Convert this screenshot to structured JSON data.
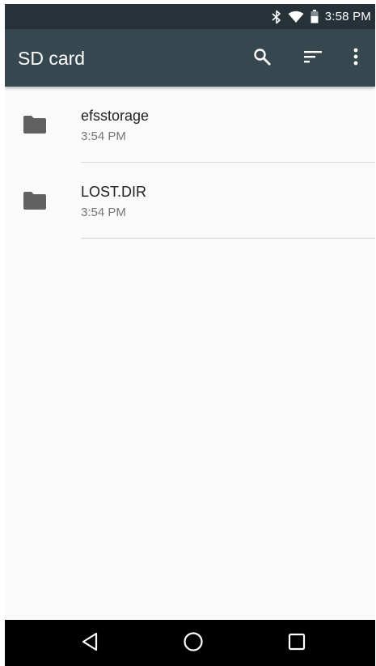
{
  "status_bar": {
    "time": "3:58 PM",
    "icons": [
      "bluetooth-icon",
      "wifi-icon",
      "battery-icon"
    ]
  },
  "app_bar": {
    "title": "SD card",
    "actions": [
      "search-icon",
      "sort-icon",
      "more-vert-icon"
    ]
  },
  "files": [
    {
      "name": "efsstorage",
      "modified": "3:54 PM",
      "icon": "folder-icon"
    },
    {
      "name": "LOST.DIR",
      "modified": "3:54 PM",
      "icon": "folder-icon"
    }
  ],
  "nav_bar": {
    "buttons": [
      "back-icon",
      "home-icon",
      "recents-icon"
    ]
  },
  "colors": {
    "status_bar_bg": "#263238",
    "app_bar_bg": "#37474f",
    "list_bg": "#fafafa",
    "folder_icon": "#616161",
    "primary_text": "#212121",
    "secondary_text": "#757575",
    "nav_bar_bg": "#000000"
  }
}
